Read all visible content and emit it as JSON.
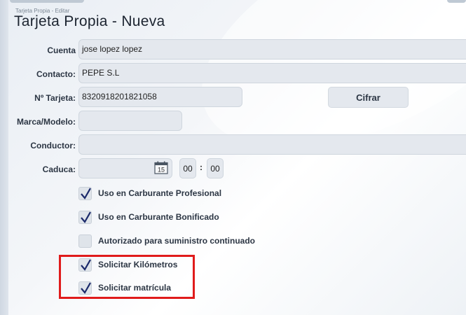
{
  "header": {
    "breadcrumb": "Tarjeta Propia - Editar",
    "title": "Tarjeta Propia - Nueva"
  },
  "form": {
    "cuenta": {
      "label": "Cuenta",
      "value": "jose lopez lopez"
    },
    "contacto": {
      "label": "Contacto:",
      "value": "PEPE S.L"
    },
    "tarjeta": {
      "label": "Nº Tarjeta:",
      "value": "8320918201821058"
    },
    "cifrar_button": "Cifrar",
    "marca": {
      "label": "Marca/Modelo:",
      "value": ""
    },
    "conductor": {
      "label": "Conductor:",
      "value": ""
    },
    "caduca": {
      "label": "Caduca:",
      "value": "",
      "calendar_day": "15",
      "hour": "00",
      "minute": "00",
      "separator": ":"
    }
  },
  "checkboxes": [
    {
      "label": "Uso en Carburante Profesional",
      "checked": true
    },
    {
      "label": "Uso en Carburante Bonificado",
      "checked": true
    },
    {
      "label": "Autorizado para suministro continuado",
      "checked": false
    },
    {
      "label": "Solicitar Kilómetros",
      "checked": true
    },
    {
      "label": "Solicitar matrícula",
      "checked": true
    }
  ],
  "colors": {
    "highlight": "#e01b1b",
    "check": "#1b2a6b"
  }
}
